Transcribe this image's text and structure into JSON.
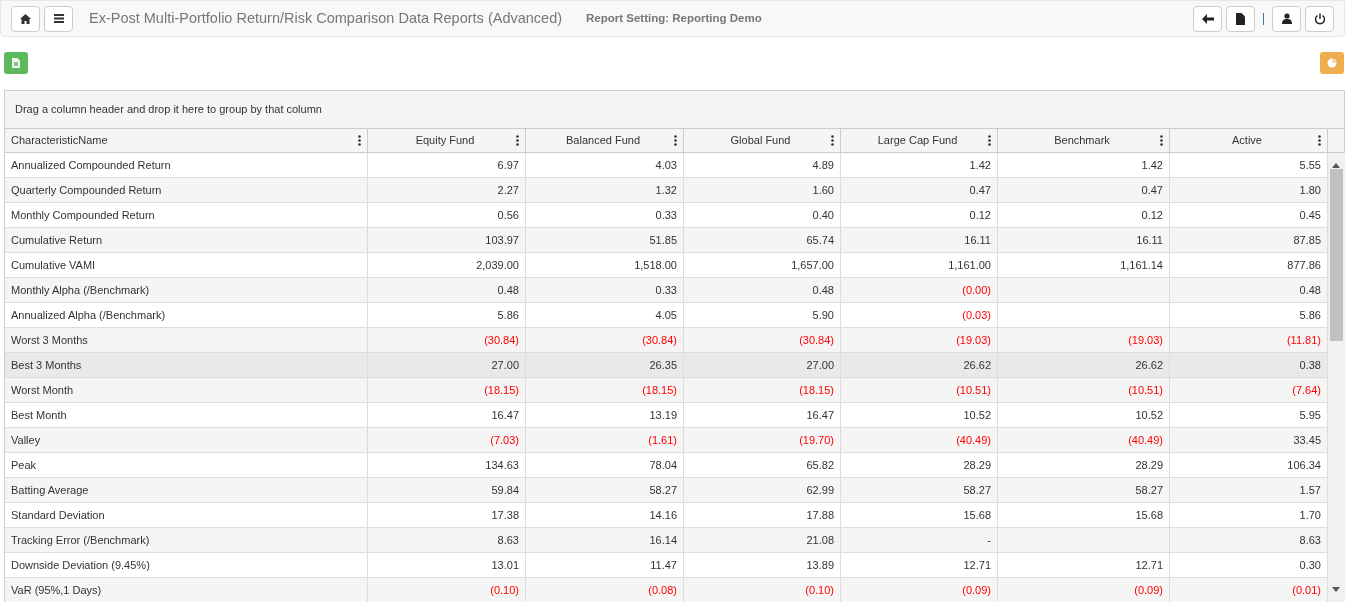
{
  "header": {
    "title": "Ex-Post Multi-Portfolio Return/Risk Comparison Data Reports (Advanced)",
    "subtitle": "Report Setting: Reporting Demo"
  },
  "grid": {
    "group_hint": "Drag a column header and drop it here to group by that column",
    "columns": [
      "CharacteristicName",
      "Equity Fund",
      "Balanced Fund",
      "Global Fund",
      "Large Cap Fund",
      "Benchmark",
      "Active"
    ],
    "rows": [
      {
        "name": "Annualized Compounded Return",
        "hovered": false,
        "cells": [
          {
            "text": "6.97",
            "negative": false
          },
          {
            "text": "4.03",
            "negative": false
          },
          {
            "text": "4.89",
            "negative": false
          },
          {
            "text": "1.42",
            "negative": false
          },
          {
            "text": "1.42",
            "negative": false
          },
          {
            "text": "5.55",
            "negative": false
          }
        ]
      },
      {
        "name": "Quarterly Compounded Return",
        "hovered": false,
        "cells": [
          {
            "text": "2.27",
            "negative": false
          },
          {
            "text": "1.32",
            "negative": false
          },
          {
            "text": "1.60",
            "negative": false
          },
          {
            "text": "0.47",
            "negative": false
          },
          {
            "text": "0.47",
            "negative": false
          },
          {
            "text": "1.80",
            "negative": false
          }
        ]
      },
      {
        "name": "Monthly Compounded Return",
        "hovered": false,
        "cells": [
          {
            "text": "0.56",
            "negative": false
          },
          {
            "text": "0.33",
            "negative": false
          },
          {
            "text": "0.40",
            "negative": false
          },
          {
            "text": "0.12",
            "negative": false
          },
          {
            "text": "0.12",
            "negative": false
          },
          {
            "text": "0.45",
            "negative": false
          }
        ]
      },
      {
        "name": "Cumulative Return",
        "hovered": false,
        "cells": [
          {
            "text": "103.97",
            "negative": false
          },
          {
            "text": "51.85",
            "negative": false
          },
          {
            "text": "65.74",
            "negative": false
          },
          {
            "text": "16.11",
            "negative": false
          },
          {
            "text": "16.11",
            "negative": false
          },
          {
            "text": "87.85",
            "negative": false
          }
        ]
      },
      {
        "name": "Cumulative VAMI",
        "hovered": false,
        "cells": [
          {
            "text": "2,039.00",
            "negative": false
          },
          {
            "text": "1,518.00",
            "negative": false
          },
          {
            "text": "1,657.00",
            "negative": false
          },
          {
            "text": "1,161.00",
            "negative": false
          },
          {
            "text": "1,161.14",
            "negative": false
          },
          {
            "text": "877.86",
            "negative": false
          }
        ]
      },
      {
        "name": "Monthly Alpha (/Benchmark)",
        "hovered": false,
        "cells": [
          {
            "text": "0.48",
            "negative": false
          },
          {
            "text": "0.33",
            "negative": false
          },
          {
            "text": "0.48",
            "negative": false
          },
          {
            "text": "(0.00)",
            "negative": true
          },
          {
            "text": "",
            "negative": false
          },
          {
            "text": "0.48",
            "negative": false
          }
        ]
      },
      {
        "name": "Annualized Alpha (/Benchmark)",
        "hovered": false,
        "cells": [
          {
            "text": "5.86",
            "negative": false
          },
          {
            "text": "4.05",
            "negative": false
          },
          {
            "text": "5.90",
            "negative": false
          },
          {
            "text": "(0.03)",
            "negative": true
          },
          {
            "text": "",
            "negative": false
          },
          {
            "text": "5.86",
            "negative": false
          }
        ]
      },
      {
        "name": "Worst 3 Months",
        "hovered": false,
        "cells": [
          {
            "text": "(30.84)",
            "negative": true
          },
          {
            "text": "(30.84)",
            "negative": true
          },
          {
            "text": "(30.84)",
            "negative": true
          },
          {
            "text": "(19.03)",
            "negative": true
          },
          {
            "text": "(19.03)",
            "negative": true
          },
          {
            "text": "(11.81)",
            "negative": true
          }
        ]
      },
      {
        "name": "Best 3 Months",
        "hovered": true,
        "cells": [
          {
            "text": "27.00",
            "negative": false
          },
          {
            "text": "26.35",
            "negative": false
          },
          {
            "text": "27.00",
            "negative": false
          },
          {
            "text": "26.62",
            "negative": false
          },
          {
            "text": "26.62",
            "negative": false
          },
          {
            "text": "0.38",
            "negative": false
          }
        ]
      },
      {
        "name": "Worst Month",
        "hovered": false,
        "cells": [
          {
            "text": "(18.15)",
            "negative": true
          },
          {
            "text": "(18.15)",
            "negative": true
          },
          {
            "text": "(18.15)",
            "negative": true
          },
          {
            "text": "(10.51)",
            "negative": true
          },
          {
            "text": "(10.51)",
            "negative": true
          },
          {
            "text": "(7.64)",
            "negative": true
          }
        ]
      },
      {
        "name": "Best Month",
        "hovered": false,
        "cells": [
          {
            "text": "16.47",
            "negative": false
          },
          {
            "text": "13.19",
            "negative": false
          },
          {
            "text": "16.47",
            "negative": false
          },
          {
            "text": "10.52",
            "negative": false
          },
          {
            "text": "10.52",
            "negative": false
          },
          {
            "text": "5.95",
            "negative": false
          }
        ]
      },
      {
        "name": "Valley",
        "hovered": false,
        "cells": [
          {
            "text": "(7.03)",
            "negative": true
          },
          {
            "text": "(1.61)",
            "negative": true
          },
          {
            "text": "(19.70)",
            "negative": true
          },
          {
            "text": "(40.49)",
            "negative": true
          },
          {
            "text": "(40.49)",
            "negative": true
          },
          {
            "text": "33.45",
            "negative": false
          }
        ]
      },
      {
        "name": "Peak",
        "hovered": false,
        "cells": [
          {
            "text": "134.63",
            "negative": false
          },
          {
            "text": "78.04",
            "negative": false
          },
          {
            "text": "65.82",
            "negative": false
          },
          {
            "text": "28.29",
            "negative": false
          },
          {
            "text": "28.29",
            "negative": false
          },
          {
            "text": "106.34",
            "negative": false
          }
        ]
      },
      {
        "name": "Batting Average",
        "hovered": false,
        "cells": [
          {
            "text": "59.84",
            "negative": false
          },
          {
            "text": "58.27",
            "negative": false
          },
          {
            "text": "62.99",
            "negative": false
          },
          {
            "text": "58.27",
            "negative": false
          },
          {
            "text": "58.27",
            "negative": false
          },
          {
            "text": "1.57",
            "negative": false
          }
        ]
      },
      {
        "name": "Standard Deviation",
        "hovered": false,
        "cells": [
          {
            "text": "17.38",
            "negative": false
          },
          {
            "text": "14.16",
            "negative": false
          },
          {
            "text": "17.88",
            "negative": false
          },
          {
            "text": "15.68",
            "negative": false
          },
          {
            "text": "15.68",
            "negative": false
          },
          {
            "text": "1.70",
            "negative": false
          }
        ]
      },
      {
        "name": "Tracking Error (/Benchmark)",
        "hovered": false,
        "cells": [
          {
            "text": "8.63",
            "negative": false
          },
          {
            "text": "16.14",
            "negative": false
          },
          {
            "text": "21.08",
            "negative": false
          },
          {
            "text": "-",
            "negative": false
          },
          {
            "text": "",
            "negative": false
          },
          {
            "text": "8.63",
            "negative": false
          }
        ]
      },
      {
        "name": "Downside Deviation (9.45%)",
        "hovered": false,
        "cells": [
          {
            "text": "13.01",
            "negative": false
          },
          {
            "text": "11.47",
            "negative": false
          },
          {
            "text": "13.89",
            "negative": false
          },
          {
            "text": "12.71",
            "negative": false
          },
          {
            "text": "12.71",
            "negative": false
          },
          {
            "text": "0.30",
            "negative": false
          }
        ]
      },
      {
        "name": "VaR (95%,1 Days)",
        "hovered": false,
        "cells": [
          {
            "text": "(0.10)",
            "negative": true
          },
          {
            "text": "(0.08)",
            "negative": true
          },
          {
            "text": "(0.10)",
            "negative": true
          },
          {
            "text": "(0.09)",
            "negative": true
          },
          {
            "text": "(0.09)",
            "negative": true
          },
          {
            "text": "(0.01)",
            "negative": true
          }
        ]
      }
    ]
  }
}
